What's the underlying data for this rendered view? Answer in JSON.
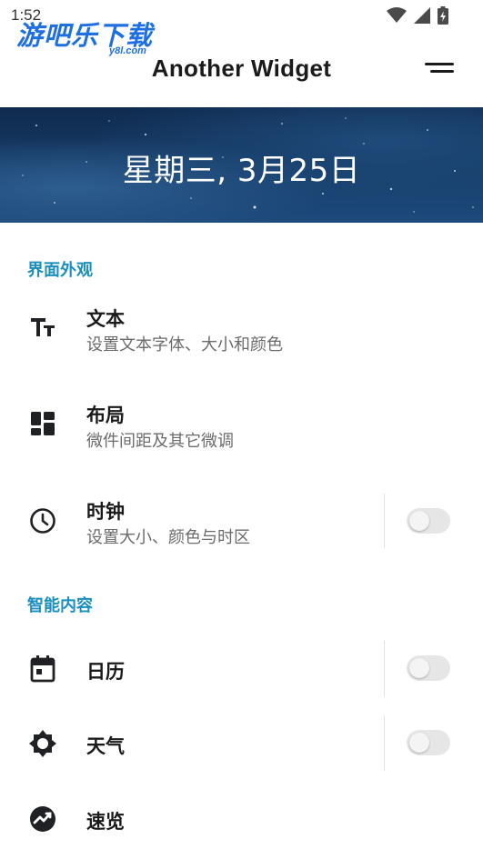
{
  "status_bar": {
    "time": "1:52"
  },
  "watermark": {
    "text": "游吧乐下载",
    "sub": "y8l.com"
  },
  "app": {
    "title": "Another Widget"
  },
  "banner": {
    "date_text": "星期三, 3月25日"
  },
  "sections": {
    "appearance": {
      "title": "界面外观",
      "items": [
        {
          "title": "文本",
          "subtitle": "设置文本字体、大小和颜色",
          "icon": "text-size-icon"
        },
        {
          "title": "布局",
          "subtitle": "微件间距及其它微调",
          "icon": "dashboard-icon"
        },
        {
          "title": "时钟",
          "subtitle": "设置大小、颜色与时区",
          "icon": "clock-icon",
          "toggle": false
        }
      ]
    },
    "smart": {
      "title": "智能内容",
      "items": [
        {
          "title": "日历",
          "icon": "calendar-icon",
          "toggle": false
        },
        {
          "title": "天气",
          "icon": "weather-icon",
          "toggle": false
        },
        {
          "title": "速览",
          "icon": "trending-icon"
        }
      ]
    }
  },
  "colors": {
    "accent": "#1a8fbf",
    "banner": "#173d69",
    "toggle_off": "#e6e6e6"
  }
}
